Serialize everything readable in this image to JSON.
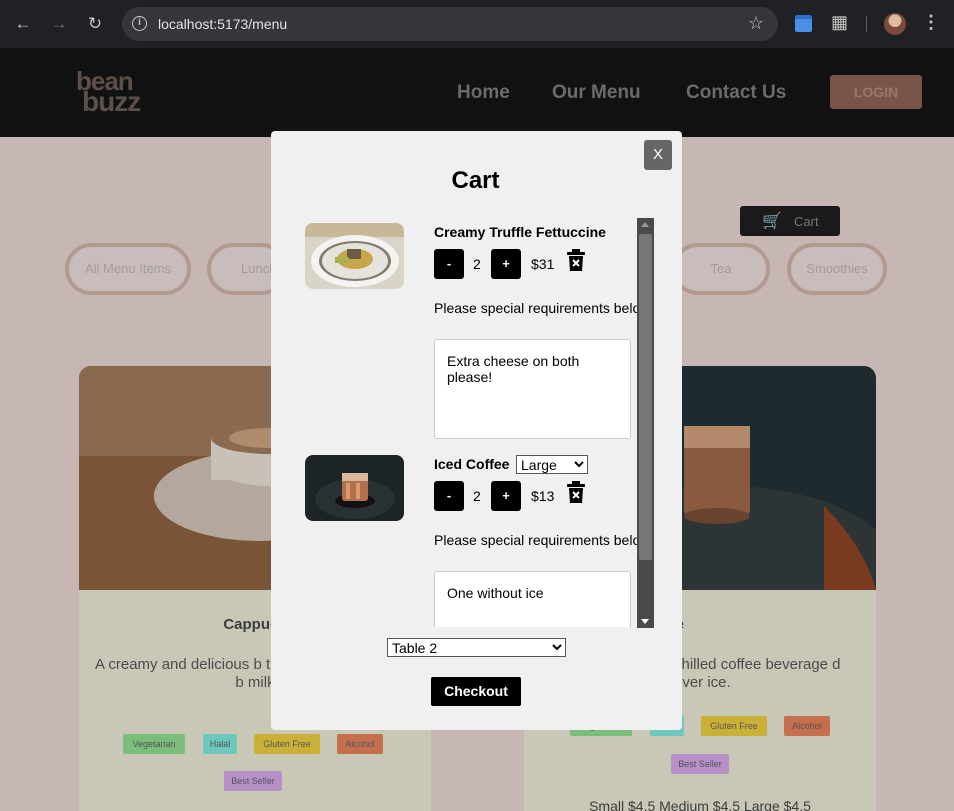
{
  "browser": {
    "url": "localhost:5173/menu",
    "back_icon": "arrow-left-icon",
    "forward_icon": "arrow-right-icon",
    "reload_icon": "reload-icon",
    "bookmark_icon": "star-icon"
  },
  "site": {
    "logo_line1": "bean",
    "logo_line2": "buzz",
    "nav": [
      "Home",
      "Our Menu",
      "Contact Us"
    ],
    "login_label": "LOGIN",
    "cart_label": "Cart",
    "categories": [
      "All Menu Items",
      "Lunch",
      "Tea",
      "Smoothies"
    ],
    "cards": [
      {
        "title": "Cappucc",
        "description": "A creamy and delicious b the finest italian coffee b milk",
        "tags": [
          "Vegetarian",
          "Halal",
          "Gluten Free",
          "Alcohol",
          "Best Seller"
        ]
      },
      {
        "title": "d Coffee",
        "description": "chilled coffee beverage d over ice.",
        "tags": [
          "Vegetarian",
          "Halal",
          "Gluten Free",
          "Alcohol",
          "Best Seller"
        ],
        "price_line": "Small $4.5 Medium $4.5 Large $4.5"
      }
    ],
    "colors": {
      "header_bg": "#111111",
      "login_bg": "#7a5447",
      "page_bg": "#c6b6b4"
    }
  },
  "cart": {
    "title": "Cart",
    "close_label": "X",
    "items": [
      {
        "name": "Creamy Truffle Fettuccine",
        "minus": "-",
        "quantity": "2",
        "plus": "+",
        "price": "$31",
        "requirements_label": "Please special requirements below",
        "requirements_text": "Extra cheese on both please!"
      },
      {
        "name": "Iced Coffee",
        "size_selected": "Large",
        "minus": "-",
        "quantity": "2",
        "plus": "+",
        "price": "$13",
        "requirements_label": "Please special requirements below",
        "requirements_text": "One without ice"
      }
    ],
    "table_selected": "Table 2",
    "checkout_label": "Checkout"
  }
}
